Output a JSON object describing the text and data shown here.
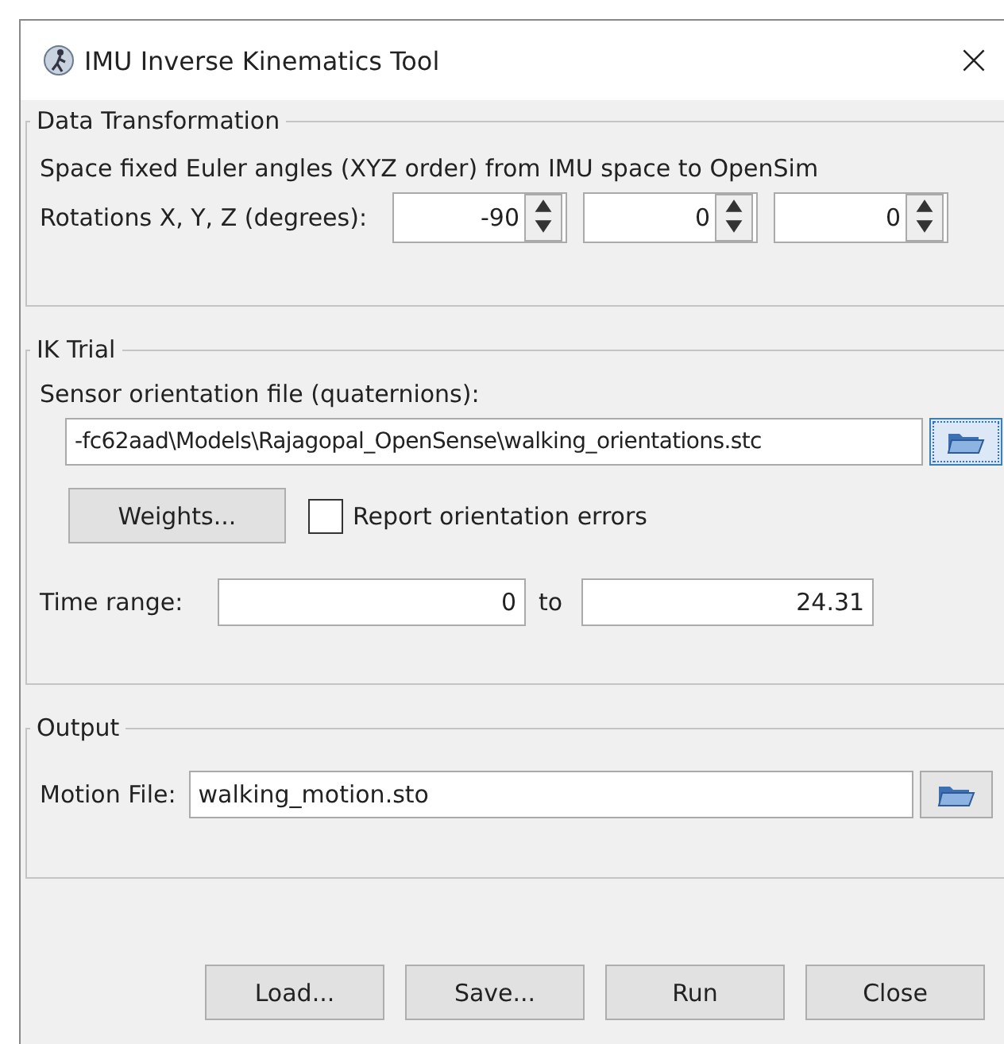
{
  "window": {
    "title": "IMU Inverse Kinematics Tool"
  },
  "data_transformation": {
    "title": "Data Transformation",
    "description": "Space fixed Euler angles (XYZ order) from IMU space to OpenSim",
    "rotations_label": "Rotations X, Y, Z (degrees):",
    "rotations": [
      "-90",
      "0",
      "0"
    ]
  },
  "ik_trial": {
    "title": "IK Trial",
    "file_label": "Sensor orientation file (quaternions):",
    "file_value": "-fc62aad\\Models\\Rajagopal_OpenSense\\walking_orientations.stc",
    "weights_button": "Weights...",
    "report_errors": {
      "label": "Report orientation errors",
      "checked": false
    },
    "time_label": "Time range:",
    "time_from": "0",
    "to_label": "to",
    "time_to": "24.31"
  },
  "output": {
    "title": "Output",
    "motion_label": "Motion File:",
    "motion_value": "walking_motion.sto"
  },
  "buttons": [
    "Load...",
    "Save...",
    "Run",
    "Close"
  ]
}
